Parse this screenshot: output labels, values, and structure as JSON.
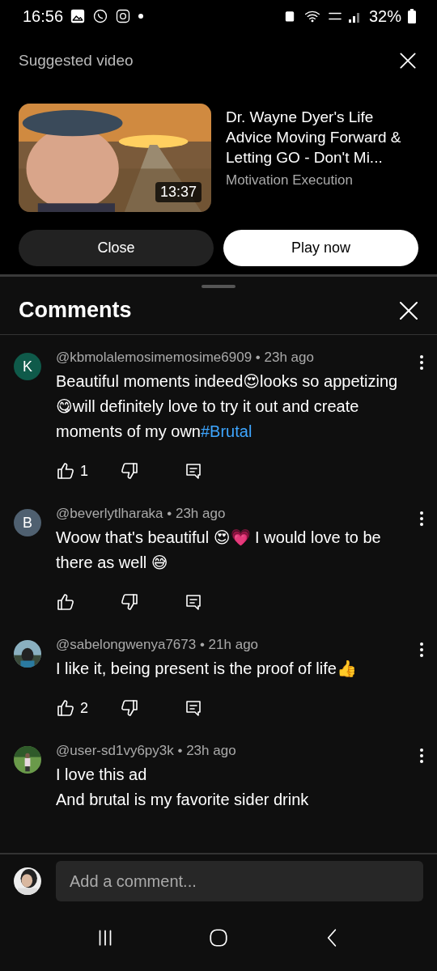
{
  "status_bar": {
    "time": "16:56",
    "battery": "32%"
  },
  "suggested": {
    "title": "Suggested video",
    "video": {
      "kind": "picture",
      "duration": "13:37",
      "title": "Dr. Wayne Dyer's Life Advice Moving Forward & Letting GO - Don't Mi...",
      "channel": "Motivation Execution"
    },
    "buttons": [
      {
        "label": "Close",
        "kind": "secondary"
      },
      {
        "label": "Play now",
        "kind": "primary"
      }
    ]
  },
  "comments_panel": {
    "title": "Comments",
    "comments": [
      {
        "avatar": {
          "kind": "letter",
          "letter": "K",
          "color": "#0f5a4a"
        },
        "meta": "@kbmolalemosimemosime6909 • 23h ago",
        "body": [
          {
            "kind": "text",
            "text": "Beautiful moments indeed😍looks so appetizing😋will definitely love to try it out and create moments of my own"
          },
          {
            "kind": "hashtag",
            "text": "#Brutal"
          }
        ],
        "has_actions": true,
        "likes": "1"
      },
      {
        "avatar": {
          "kind": "letter",
          "letter": "B",
          "color": "#4f6070"
        },
        "meta": "@beverlytlharaka • 23h ago",
        "body": [
          {
            "kind": "text",
            "text": "Woow that's beautiful 😍💗 I would love to be there as well 😅"
          }
        ],
        "has_actions": true
      },
      {
        "avatar": {
          "kind": "picture"
        },
        "meta": "@sabelongwenya7673 • 21h ago",
        "body": [
          {
            "kind": "text",
            "text": "I like it, being present is the proof of life👍"
          }
        ],
        "has_actions": true,
        "likes": "2"
      },
      {
        "avatar": {
          "kind": "picture"
        },
        "meta": "@user-sd1vy6py3k • 23h ago",
        "has_actions": false,
        "body": [
          {
            "kind": "text",
            "text": "I love this ad"
          },
          {
            "kind": "break"
          },
          {
            "kind": "text",
            "text": "And brutal is my favorite sider drink"
          }
        ]
      }
    ],
    "composer": {
      "placeholder": "Add a comment..."
    }
  }
}
